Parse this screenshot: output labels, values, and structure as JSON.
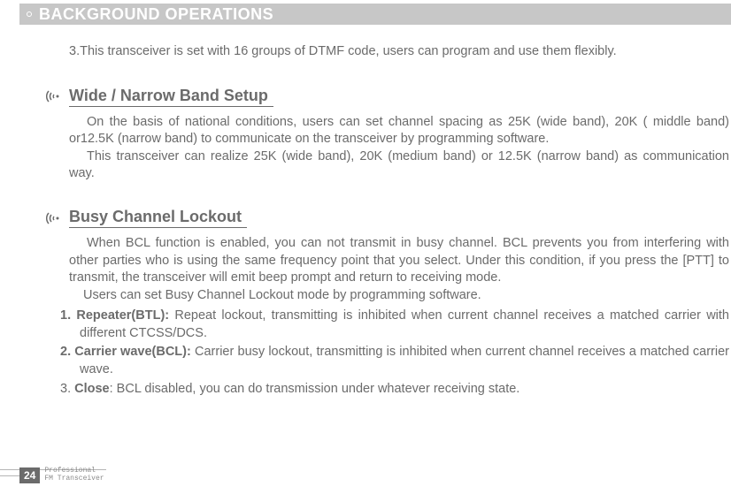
{
  "header": {
    "title": "BACKGROUND OPERATIONS"
  },
  "intro": "3.This transceiver is set with 16 groups of DTMF code, users can program and use them flexibly.",
  "section1": {
    "title": "Wide / Narrow Band Setup",
    "p1": "On the basis of national conditions, users can set channel spacing as 25K (wide band), 20K ( middle band) or12.5K (narrow band) to communicate on the transceiver by programming software.",
    "p2": "This transceiver can realize 25K (wide band), 20K (medium band) or 12.5K (narrow band) as communication way."
  },
  "section2": {
    "title": "Busy Channel Lockout",
    "p1": "When BCL function is enabled, you can not transmit in busy channel. BCL prevents you from interfering with other parties who is using the same frequency point that you select. Under this condition, if you press the [PTT] to transmit, the transceiver will emit beep prompt and return to receiving mode.",
    "p2": "Users can set Busy Channel Lockout mode by programming software.",
    "items": [
      {
        "num": "1. ",
        "bold": "Repeater(BTL): ",
        "rest": "Repeat lockout, transmitting is inhibited when current channel receives a matched carrier with different CTCSS/DCS."
      },
      {
        "num": "2. ",
        "bold": "Carrier wave(BCL): ",
        "rest": "Carrier busy lockout, transmitting is inhibited when current channel receives a matched carrier wave."
      },
      {
        "num": "3. ",
        "bold": " Close",
        "rest": ": BCL disabled, you can do transmission under whatever receiving state."
      }
    ]
  },
  "footer": {
    "page": "24",
    "line1": "Professional",
    "line2": "FM Transceiver"
  }
}
